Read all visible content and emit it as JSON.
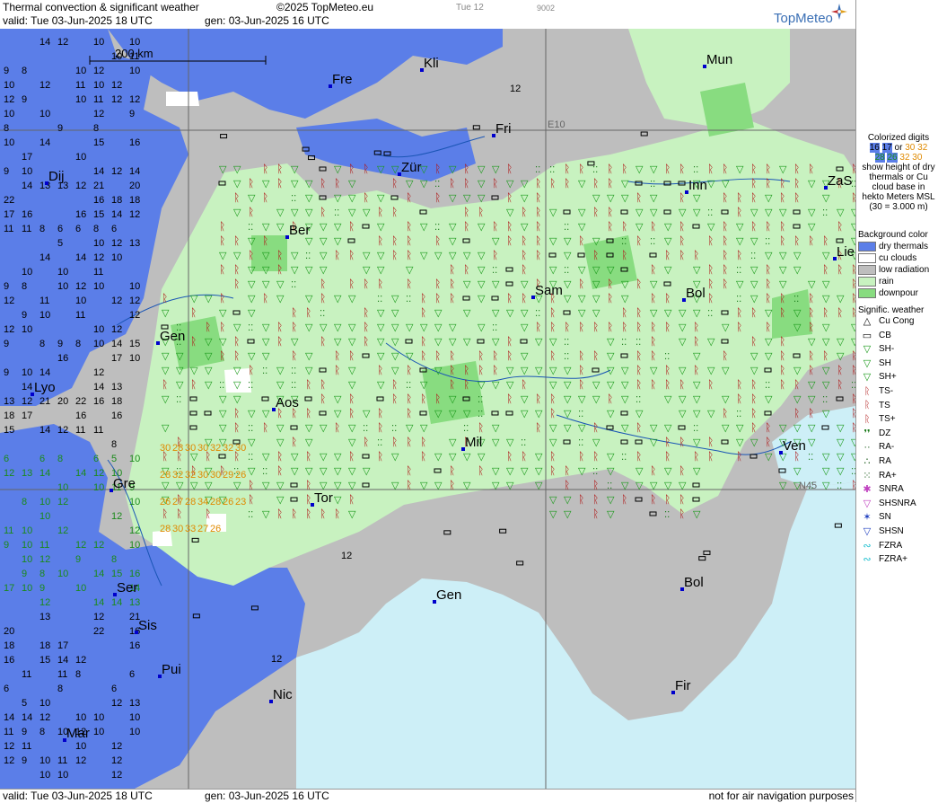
{
  "header": {
    "title": "Thermal convection & significant weather",
    "copyright": "©2025 TopMeteo.eu",
    "valid": "valid:  Tue  03-Jun-2025  18 UTC",
    "generated": "gen:  03-Jun-2025 16 UTC",
    "date_label": "Tue 12",
    "code": "9002",
    "logo": "TopMeteo"
  },
  "footer": {
    "valid": "valid:  Tue  03-Jun-2025  18 UTC",
    "generated": "gen:  03-Jun-2025 16 UTC",
    "disclaimer": "not for air navigation purposes"
  },
  "scale": {
    "label": "200 km"
  },
  "cities": [
    {
      "name": "Mun"
    },
    {
      "name": "Kli"
    },
    {
      "name": "Fre"
    },
    {
      "name": "Fri"
    },
    {
      "name": "Zür"
    },
    {
      "name": "Dij"
    },
    {
      "name": "Inn"
    },
    {
      "name": "ZaS"
    },
    {
      "name": "Ber"
    },
    {
      "name": "Lie"
    },
    {
      "name": "Sam"
    },
    {
      "name": "Bol"
    },
    {
      "name": "Gen"
    },
    {
      "name": "Lyo"
    },
    {
      "name": "Aos"
    },
    {
      "name": "Mil"
    },
    {
      "name": "Ven"
    },
    {
      "name": "Gre"
    },
    {
      "name": "Tor"
    },
    {
      "name": "Ser"
    },
    {
      "name": "Gen"
    },
    {
      "name": "Bol"
    },
    {
      "name": "Sis"
    },
    {
      "name": "Pui"
    },
    {
      "name": "Nic"
    },
    {
      "name": "Fir"
    },
    {
      "name": "Mar"
    }
  ],
  "grid_labels": {
    "e10": "E10",
    "n45": "N45"
  },
  "legend": {
    "colorized_title": "Colorized digits",
    "colorized_or": "or",
    "digit_samples": [
      "16",
      "17",
      "30",
      "32",
      "28",
      "26",
      "32",
      "30"
    ],
    "colorized_text": "show height of dry thermals or Cu cloud base in hekto Meters MSL",
    "colorized_example": "(30 = 3.000 m)",
    "background_title": "Background color",
    "background": [
      {
        "label": "dry thermals",
        "color": "#5b7ee8"
      },
      {
        "label": "cu clouds",
        "color": "#ffffff"
      },
      {
        "label": "low radiation",
        "color": "#bebebe"
      },
      {
        "label": "rain",
        "color": "#c8f2c0"
      },
      {
        "label": "downpour",
        "color": "#88dc80"
      }
    ],
    "weather_title": "Signific. weather",
    "weather": [
      {
        "label": "Cu Cong",
        "icon": "cu-cong-icon"
      },
      {
        "label": "CB",
        "icon": "cb-icon"
      },
      {
        "label": "SH-",
        "icon": "shower-light-icon"
      },
      {
        "label": "SH",
        "icon": "shower-icon"
      },
      {
        "label": "SH+",
        "icon": "shower-heavy-icon"
      },
      {
        "label": "TS-",
        "icon": "thunderstorm-light-icon"
      },
      {
        "label": "TS",
        "icon": "thunderstorm-icon"
      },
      {
        "label": "TS+",
        "icon": "thunderstorm-heavy-icon"
      },
      {
        "label": "DZ",
        "icon": "drizzle-icon"
      },
      {
        "label": "RA-",
        "icon": "rain-light-icon"
      },
      {
        "label": "RA",
        "icon": "rain-icon"
      },
      {
        "label": "RA+",
        "icon": "rain-heavy-icon"
      },
      {
        "label": "SNRA",
        "icon": "snow-rain-icon"
      },
      {
        "label": "SHSNRA",
        "icon": "snow-rain-shower-icon"
      },
      {
        "label": "SN",
        "icon": "snow-icon"
      },
      {
        "label": "SHSN",
        "icon": "snow-shower-icon"
      },
      {
        "label": "FZRA",
        "icon": "freezing-rain-icon"
      },
      {
        "label": "FZRA+",
        "icon": "freezing-rain-heavy-icon"
      }
    ]
  },
  "colors": {
    "dry_thermals": "#5b7ee8",
    "cu_clouds": "#ffffff",
    "low_radiation": "#bebebe",
    "rain": "#c8f2c0",
    "downpour": "#88dc80",
    "sea": "#cdeff7",
    "coast": "#4a6ab0",
    "thunder": "#b01818",
    "shower": "#1a9a1a",
    "digits_orange": "#e08a00",
    "digits_green": "#1a8a1a"
  },
  "digits": {
    "west_column": [
      "14",
      "12",
      "10",
      "10",
      "10",
      "11",
      "9",
      "8",
      "10",
      "12",
      "10",
      "10",
      "12",
      "11",
      "10",
      "12",
      "12",
      "9",
      "10",
      "11",
      "12",
      "12",
      "10",
      "10",
      "12",
      "9",
      "8",
      "9",
      "8",
      "10",
      "14",
      "15",
      "16",
      "17",
      "10",
      "9",
      "10",
      "14",
      "12",
      "14",
      "14",
      "13",
      "13",
      "12",
      "21",
      "20",
      "22",
      "16",
      "18",
      "18",
      "17",
      "16",
      "16",
      "15",
      "14",
      "12",
      "11",
      "11",
      "8",
      "6",
      "6",
      "8",
      "6",
      "5",
      "10",
      "12",
      "13",
      "14"
    ],
    "orange_cluster": [
      "30",
      "28",
      "30",
      "30",
      "32",
      "32",
      "30",
      "28",
      "32",
      "32",
      "30",
      "30",
      "29",
      "26",
      "26",
      "27",
      "28",
      "34",
      "28",
      "26",
      "23",
      "28",
      "30",
      "33",
      "27",
      "26"
    ],
    "east_samples": [
      "12",
      "12",
      "12"
    ]
  }
}
